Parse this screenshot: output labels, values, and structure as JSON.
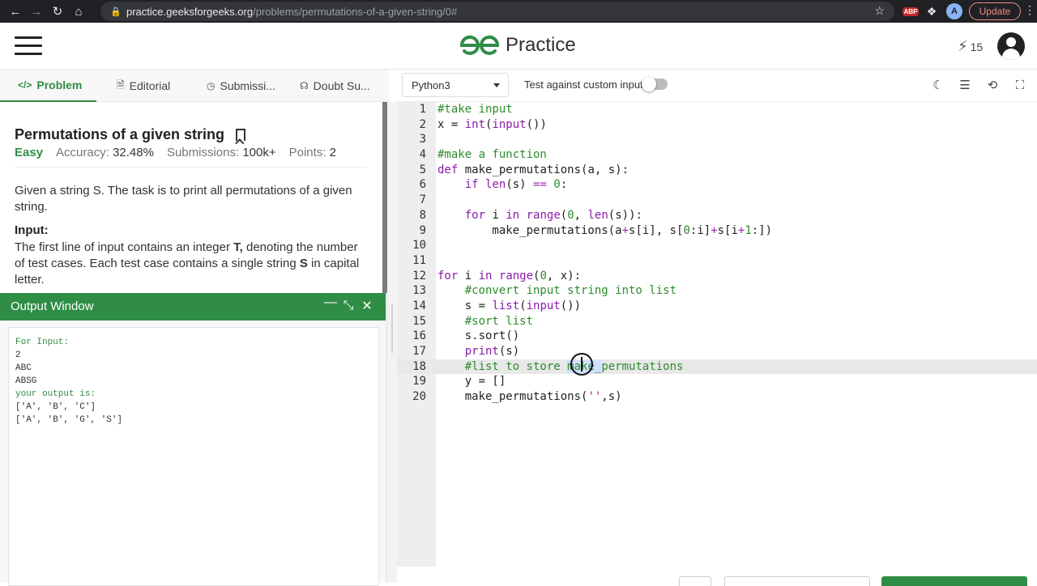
{
  "browser": {
    "url_host": "practice.geeksforgeeks.org",
    "url_path": "/problems/permutations-of-a-given-string/0#",
    "update_label": "Update",
    "ext_abp_label": "ABP",
    "profile_initial": "A"
  },
  "header": {
    "logo_text": "Practice",
    "streak_count": "15"
  },
  "tabs": [
    {
      "label": "Problem",
      "icon": "code-icon",
      "active": true
    },
    {
      "label": "Editorial",
      "icon": "document-icon",
      "active": false
    },
    {
      "label": "Submissi...",
      "icon": "clock-icon",
      "active": false
    },
    {
      "label": "Doubt Su...",
      "icon": "headset-icon",
      "active": false
    }
  ],
  "problem": {
    "title": "Permutations of a given string",
    "difficulty": "Easy",
    "accuracy_label": "Accuracy:",
    "accuracy_value": "32.48%",
    "submissions_label": "Submissions:",
    "submissions_value": "100k+",
    "points_label": "Points:",
    "points_value": "2",
    "description": "Given a string S. The task is to print all permutations of a given string.",
    "input_heading": "Input:",
    "input_desc_1": "The first line of input contains an integer ",
    "input_desc_bold_1": "T,",
    "input_desc_2": " denoting the number of test cases. Each test case contains a single string ",
    "input_desc_bold_2": "S",
    "input_desc_3": " in capital letter."
  },
  "output_window": {
    "title": "Output Window",
    "lines": [
      {
        "text": "For Input:",
        "green": true
      },
      {
        "text": "2",
        "green": false
      },
      {
        "text": "ABC",
        "green": false
      },
      {
        "text": "ABSG",
        "green": false
      },
      {
        "text": "your output is:",
        "green": true
      },
      {
        "text": "['A', 'B', 'C']",
        "green": false
      },
      {
        "text": "['A', 'B', 'G', 'S']",
        "green": false
      }
    ]
  },
  "editor": {
    "language": "Python3",
    "custom_input_label": "Test against custom input",
    "custom_input_enabled": false,
    "active_line": 18,
    "code_lines": [
      "#take input",
      "x = int(input())",
      "",
      "#make a function",
      "def make_permutations(a, s):",
      "    if len(s) == 0:",
      "",
      "    for i in range(0, len(s)):",
      "        make_permutations(a+s[i], s[0:i]+s[i+1:])",
      "",
      "",
      "for i in range(0, x):",
      "    #convert input string into list",
      "    s = list(input())",
      "    #sort list",
      "    s.sort()",
      "    print(s)",
      "    #list to store make_permutations",
      "    y = []",
      "    make_permutations('',s)"
    ]
  },
  "colors": {
    "brand_green": "#2f8d46",
    "comment_green": "#2e8b2e",
    "keyword_purple": "#8b1ba8"
  }
}
